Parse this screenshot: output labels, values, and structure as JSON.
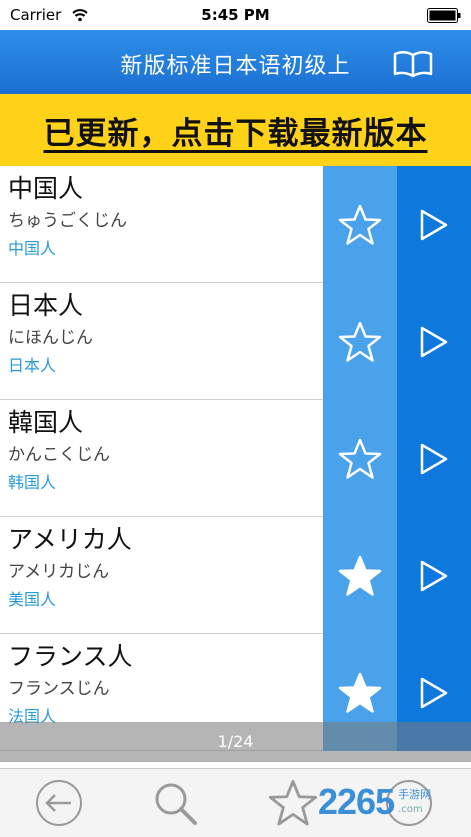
{
  "status_bar": {
    "carrier": "Carrier",
    "time": "5:45 PM"
  },
  "header": {
    "title": "新版标准日本语初级上"
  },
  "banner": {
    "text": "已更新，点击下载最新版本"
  },
  "words": [
    {
      "kanji": "中国人",
      "kana": "ちゅうごくじん",
      "meaning": "中国人",
      "starred": false
    },
    {
      "kanji": "日本人",
      "kana": "にほんじん",
      "meaning": "日本人",
      "starred": false
    },
    {
      "kanji": "韓国人",
      "kana": "かんこくじん",
      "meaning": "韩国人",
      "starred": false
    },
    {
      "kanji": "アメリカ人",
      "kana": "アメリカじん",
      "meaning": "美国人",
      "starred": true
    },
    {
      "kanji": "フランス人",
      "kana": "フランスじん",
      "meaning": "法国人",
      "starred": true
    }
  ],
  "pager": {
    "text": "1/24"
  },
  "watermark": {
    "number": "2265",
    "label": "手游网",
    "site": ".com"
  },
  "colors": {
    "nav_blue": "#1b6fd2",
    "banner_yellow": "#ffd21a",
    "fav_blue": "#4aa2ea",
    "play_blue": "#0f78dc",
    "meaning_blue": "#2a9bd6"
  },
  "icons": {
    "book": "book-icon",
    "star_outline": "star-outline-icon",
    "star_filled": "star-filled-icon",
    "play": "play-icon",
    "back": "back-icon",
    "search": "search-icon",
    "favorites": "favorites-star-icon",
    "next": "next-icon"
  }
}
